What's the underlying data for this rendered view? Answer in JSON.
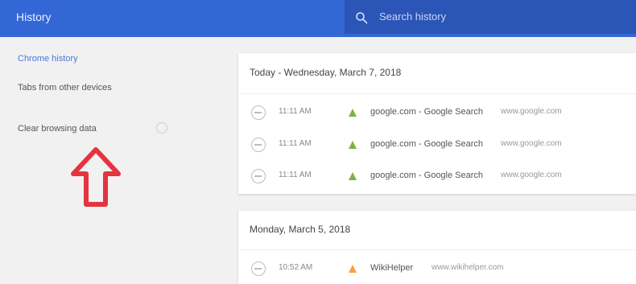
{
  "app": {
    "title": "History"
  },
  "search": {
    "placeholder": "Search history"
  },
  "sidebar": {
    "items": [
      {
        "label": "Chrome history",
        "active": true
      },
      {
        "label": "Tabs from other devices",
        "active": false
      },
      {
        "label": "Clear browsing data",
        "active": false
      }
    ]
  },
  "groups": [
    {
      "header": "Today - Wednesday, March 7, 2018",
      "entries": [
        {
          "time": "11:11 AM",
          "title": "google.com - Google Search",
          "domain": "www.google.com",
          "favicon": "google-favicon-icon"
        },
        {
          "time": "11:11 AM",
          "title": "google.com - Google Search",
          "domain": "www.google.com",
          "favicon": "google-favicon-icon"
        },
        {
          "time": "11:11 AM",
          "title": "google.com - Google Search",
          "domain": "www.google.com",
          "favicon": "google-favicon-icon"
        }
      ]
    },
    {
      "header": "Monday, March 5, 2018",
      "entries": [
        {
          "time": "10:52 AM",
          "title": "WikiHelper",
          "domain": "www.wikihelper.com",
          "favicon": "orange-favicon-icon"
        }
      ]
    }
  ],
  "colors": {
    "topbar": "#3367d6",
    "search": "#2b55b6",
    "background": "#f1f1f1",
    "arrow": "#e3343f",
    "accent": "#4a78d8"
  },
  "icons": {
    "search": "search-icon",
    "annotation_arrow": "up-arrow-icon"
  }
}
